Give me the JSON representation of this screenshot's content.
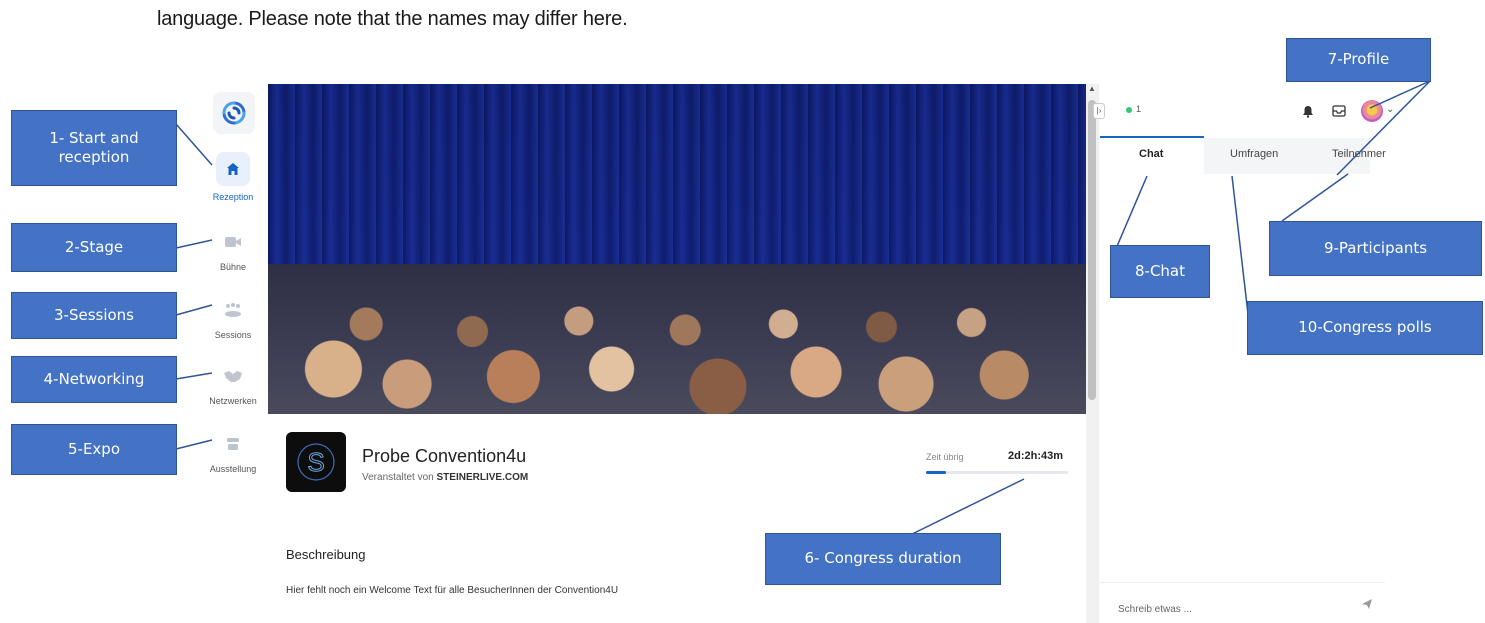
{
  "intro_text": "language. Please note that the names may differ here.",
  "nav": {
    "logo_icon": "swirl-logo-icon",
    "items": [
      {
        "label": "Rezeption",
        "icon": "home-icon",
        "active": true
      },
      {
        "label": "Bühne",
        "icon": "video-camera-icon",
        "active": false
      },
      {
        "label": "Sessions",
        "icon": "group-icon",
        "active": false
      },
      {
        "label": "Netzwerken",
        "icon": "handshake-icon",
        "active": false
      },
      {
        "label": "Ausstellung",
        "icon": "booth-icon",
        "active": false
      }
    ]
  },
  "event": {
    "title": "Probe Convention4u",
    "organizer_prefix": "Veranstaltet von",
    "organizer": "STEINERLIVE.COM",
    "time_label": "Zeit übrig",
    "time_value": "2d:2h:43m",
    "progress_fraction": 0.14,
    "description_title": "Beschreibung",
    "description_text": "Hier fehlt noch ein Welcome Text für alle BesucherInnen der Convention4U"
  },
  "right_panel": {
    "online_count": "1",
    "tabs": [
      {
        "label": "Chat",
        "active": true
      },
      {
        "label": "Umfragen",
        "active": false
      },
      {
        "label": "Teilnehmer",
        "active": false
      }
    ],
    "chat_placeholder": "Schreib etwas ...",
    "icons": [
      "bell-icon",
      "inbox-icon",
      "avatar",
      "chevron-down-icon"
    ]
  },
  "callouts": {
    "c1": "1- Start and reception",
    "c2": "2-Stage",
    "c3": "3-Sessions",
    "c4": "4-Networking",
    "c5": "5-Expo",
    "c6": "6- Congress duration",
    "c7": "7-Profile",
    "c8": "8-Chat",
    "c9": "9-Participants",
    "c10": "10-Congress polls"
  },
  "colors": {
    "accent": "#1565c0",
    "callout_fill": "#4472c4",
    "online_dot": "#2ecc71"
  }
}
